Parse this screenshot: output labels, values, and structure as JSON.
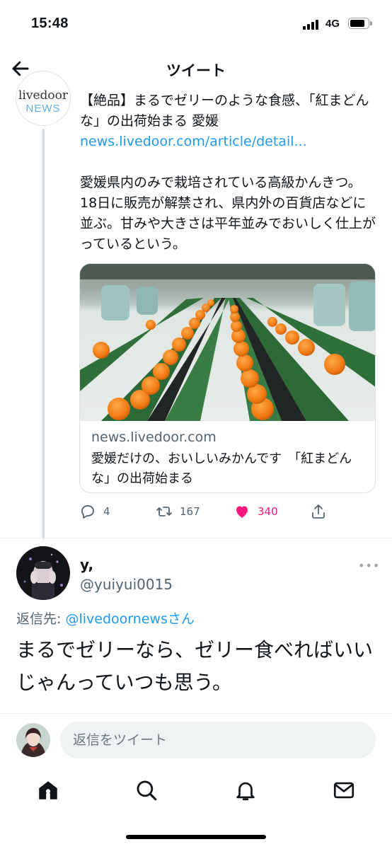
{
  "status_bar": {
    "time": "15:48",
    "network": "4G"
  },
  "header": {
    "title": "ツイート"
  },
  "tweet": {
    "avatar": {
      "line1": "livedoor",
      "line2": "NEWS"
    },
    "headline": "【絶品】まるでゼリーのような食感、「紅まどんな」の出荷始まる 愛媛",
    "link": "news.livedoor.com/article/detail...",
    "body": "愛媛県内のみで栽培されている高級かんきつ。18日に販売が解禁され、県内外の百貨店などに並ぶ。甘みや大きさは平年並みでおいしく仕上がっているという。",
    "card": {
      "domain": "news.livedoor.com",
      "description": "愛媛だけの、おいしいみかんです　「紅まどんな」の出荷始まる"
    },
    "actions": {
      "replies": "4",
      "retweets": "167",
      "likes": "340"
    }
  },
  "reply": {
    "name": "y,",
    "handle": "@yuiyui0015",
    "reply_to_label": "返信先: ",
    "reply_to_mention": "@livedoornewsさん",
    "text": "まるでゼリーなら、ゼリー食べればいいじゃんっていつも思う。"
  },
  "compose": {
    "placeholder": "返信をツイート"
  },
  "colors": {
    "link": "#1d9bf0",
    "like": "#f91880",
    "secondary": "#536471"
  },
  "icons": [
    "back-arrow-icon",
    "reply-icon",
    "retweet-icon",
    "like-icon",
    "share-icon",
    "more-icon",
    "home-icon",
    "search-icon",
    "notifications-icon",
    "messages-icon"
  ]
}
